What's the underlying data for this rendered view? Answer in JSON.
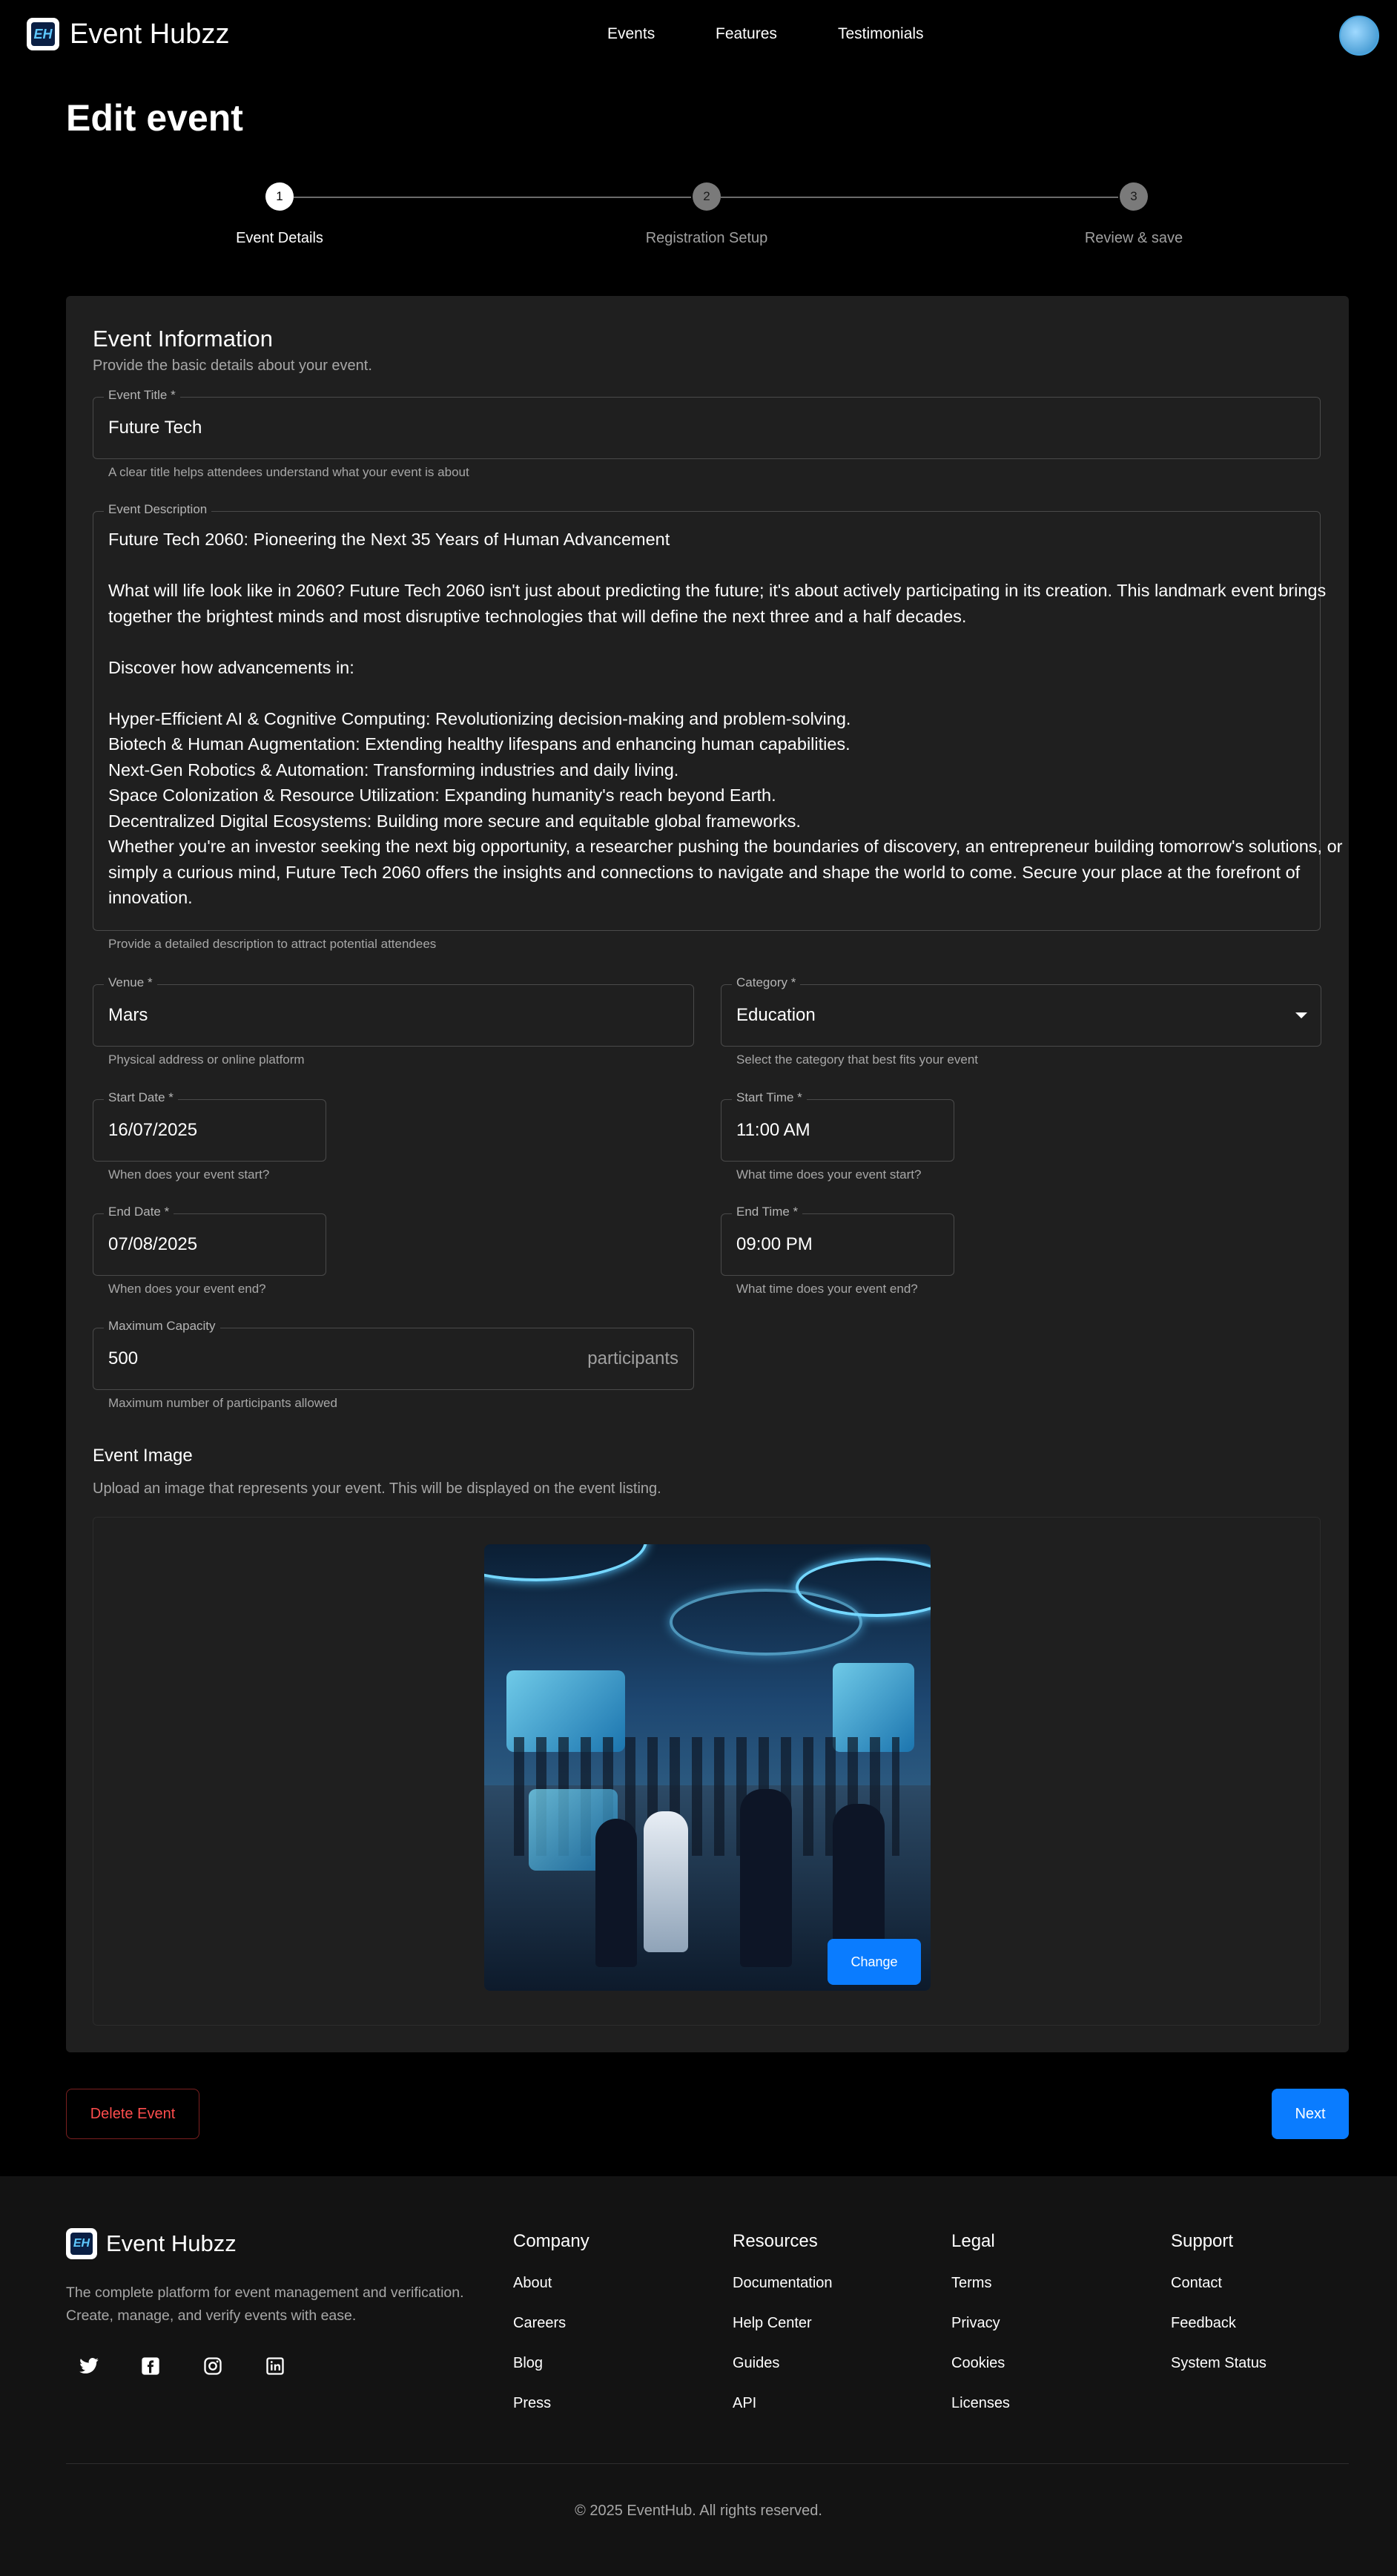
{
  "header": {
    "brand": "Event Hubzz",
    "logo_text": "EH",
    "nav": [
      "Events",
      "Features",
      "Testimonials"
    ]
  },
  "page_title": "Edit event",
  "stepper": {
    "steps": [
      {
        "number": "1",
        "label": "Event Details",
        "state": "active"
      },
      {
        "number": "2",
        "label": "Registration Setup",
        "state": "inactive"
      },
      {
        "number": "3",
        "label": "Review & save",
        "state": "inactive"
      }
    ]
  },
  "event_info": {
    "title": "Event Information",
    "subtitle": "Provide the basic details about your event.",
    "event_title": {
      "label": "Event Title *",
      "value": "Future Tech",
      "helper": "A clear title helps attendees understand what your event is about"
    },
    "description": {
      "label": "Event Description",
      "paragraphs": [
        "Future Tech 2060: Pioneering the Next 35 Years of Human Advancement",
        "What will life look like in 2060? Future Tech 2060 isn't just about predicting the future; it's about actively participating in its creation. This landmark event brings together the brightest minds and most disruptive technologies that will define the next three and a half decades.",
        "Discover how advancements in:",
        "Hyper-Efficient AI & Cognitive Computing: Revolutionizing decision-making and problem-solving.\nBiotech & Human Augmentation: Extending healthy lifespans and enhancing human capabilities.\nNext-Gen Robotics & Automation: Transforming industries and daily living.\nSpace Colonization & Resource Utilization: Expanding humanity's reach beyond Earth.\nDecentralized Digital Ecosystems: Building more secure and equitable global frameworks.\nWhether you're an investor seeking the next big opportunity, a researcher pushing the boundaries of discovery, an entrepreneur building tomorrow's solutions, or simply a curious mind, Future Tech 2060 offers the insights and connections to navigate and shape the world to come. Secure your place at the forefront of innovation."
      ],
      "helper": "Provide a detailed description to attract potential attendees"
    },
    "venue": {
      "label": "Venue *",
      "value": "Mars",
      "helper": "Physical address or online platform"
    },
    "category": {
      "label": "Category *",
      "value": "Education",
      "helper": "Select the category that best fits your event"
    },
    "start_date": {
      "label": "Start Date *",
      "value": "16/07/2025",
      "helper": "When does your event start?"
    },
    "start_time": {
      "label": "Start Time *",
      "value": "11:00 AM",
      "helper": "What time does your event start?"
    },
    "end_date": {
      "label": "End Date *",
      "value": "07/08/2025",
      "helper": "When does your event end?"
    },
    "end_time": {
      "label": "End Time *",
      "value": "09:00 PM",
      "helper": "What time does your event end?"
    },
    "capacity": {
      "label": "Maximum Capacity",
      "value": "500",
      "suffix": "participants",
      "helper": "Maximum number of participants allowed"
    }
  },
  "event_image": {
    "title": "Event Image",
    "subtitle": "Upload an image that represents your event. This will be displayed on the event listing.",
    "change_label": "Change"
  },
  "actions": {
    "delete_label": "Delete Event",
    "next_label": "Next"
  },
  "footer": {
    "brand": "Event Hubzz",
    "logo_text": "EH",
    "description": "The complete platform for event management and verification. Create, manage, and verify events with ease.",
    "social_icons": [
      "twitter-icon",
      "facebook-icon",
      "instagram-icon",
      "linkedin-icon"
    ],
    "columns": [
      {
        "title": "Company",
        "links": [
          "About",
          "Careers",
          "Blog",
          "Press"
        ]
      },
      {
        "title": "Resources",
        "links": [
          "Documentation",
          "Help Center",
          "Guides",
          "API"
        ]
      },
      {
        "title": "Legal",
        "links": [
          "Terms",
          "Privacy",
          "Cookies",
          "Licenses"
        ]
      },
      {
        "title": "Support",
        "links": [
          "Contact",
          "Feedback",
          "System Status"
        ]
      }
    ],
    "copyright": "© 2025 EventHub. All rights reserved."
  },
  "colors": {
    "accent": "#0a7cff",
    "danger": "#ff4d4d",
    "card_bg": "#1f1f1f",
    "page_bg": "#000000",
    "footer_bg": "#131313"
  }
}
